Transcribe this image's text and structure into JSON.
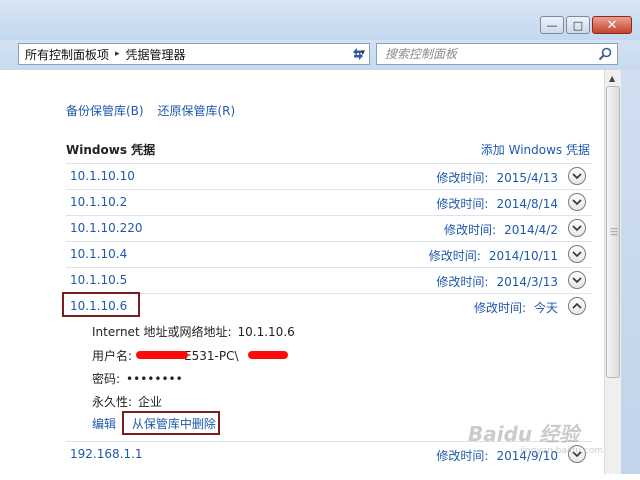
{
  "window": {
    "minimize_glyph": "—",
    "maximize_glyph": "□",
    "close_glyph": "✕"
  },
  "address": {
    "crumbs": [
      "所有控制面板项",
      "凭据管理器"
    ],
    "separator": "▸",
    "dropdown": "▾"
  },
  "search": {
    "placeholder": "搜索控制面板"
  },
  "links": {
    "backup": "备份保管库(B)",
    "restore": "还原保管库(R)"
  },
  "section": {
    "title": "Windows 凭据",
    "add": "添加 Windows 凭据"
  },
  "credentials": [
    {
      "address": "10.1.10.10",
      "label": "修改时间:",
      "date": "2015/4/13",
      "expanded": false
    },
    {
      "address": "10.1.10.2",
      "label": "修改时间:",
      "date": "2014/8/14",
      "expanded": false
    },
    {
      "address": "10.1.10.220",
      "label": "修改时间:",
      "date": "2014/4/2",
      "expanded": false
    },
    {
      "address": "10.1.10.4",
      "label": "修改时间:",
      "date": "2014/10/11",
      "expanded": false
    },
    {
      "address": "10.1.10.5",
      "label": "修改时间:",
      "date": "2014/3/13",
      "expanded": false
    },
    {
      "address": "10.1.10.6",
      "label": "修改时间:",
      "date": "今天",
      "expanded": true
    },
    {
      "address": "192.168.1.1",
      "label": "修改时间:",
      "date": "2014/9/10",
      "expanded": false
    }
  ],
  "details": {
    "internet_label": "Internet 地址或网络地址:",
    "internet_value": "10.1.10.6",
    "user_label": "用户名:",
    "user_value": "E531-PC\\",
    "password_label": "密码:",
    "password_value": "••••••••",
    "persistence_label": "永久性:",
    "persistence_value": "企业",
    "edit": "编辑",
    "remove": "从保管库中删除"
  },
  "watermark": {
    "text": "Baidu 经验",
    "sub": "jingyan.baidu.com"
  },
  "colors": {
    "link": "#1f58b0",
    "highlight": "#7b1d1d",
    "redaction": "#ff0a0a"
  }
}
